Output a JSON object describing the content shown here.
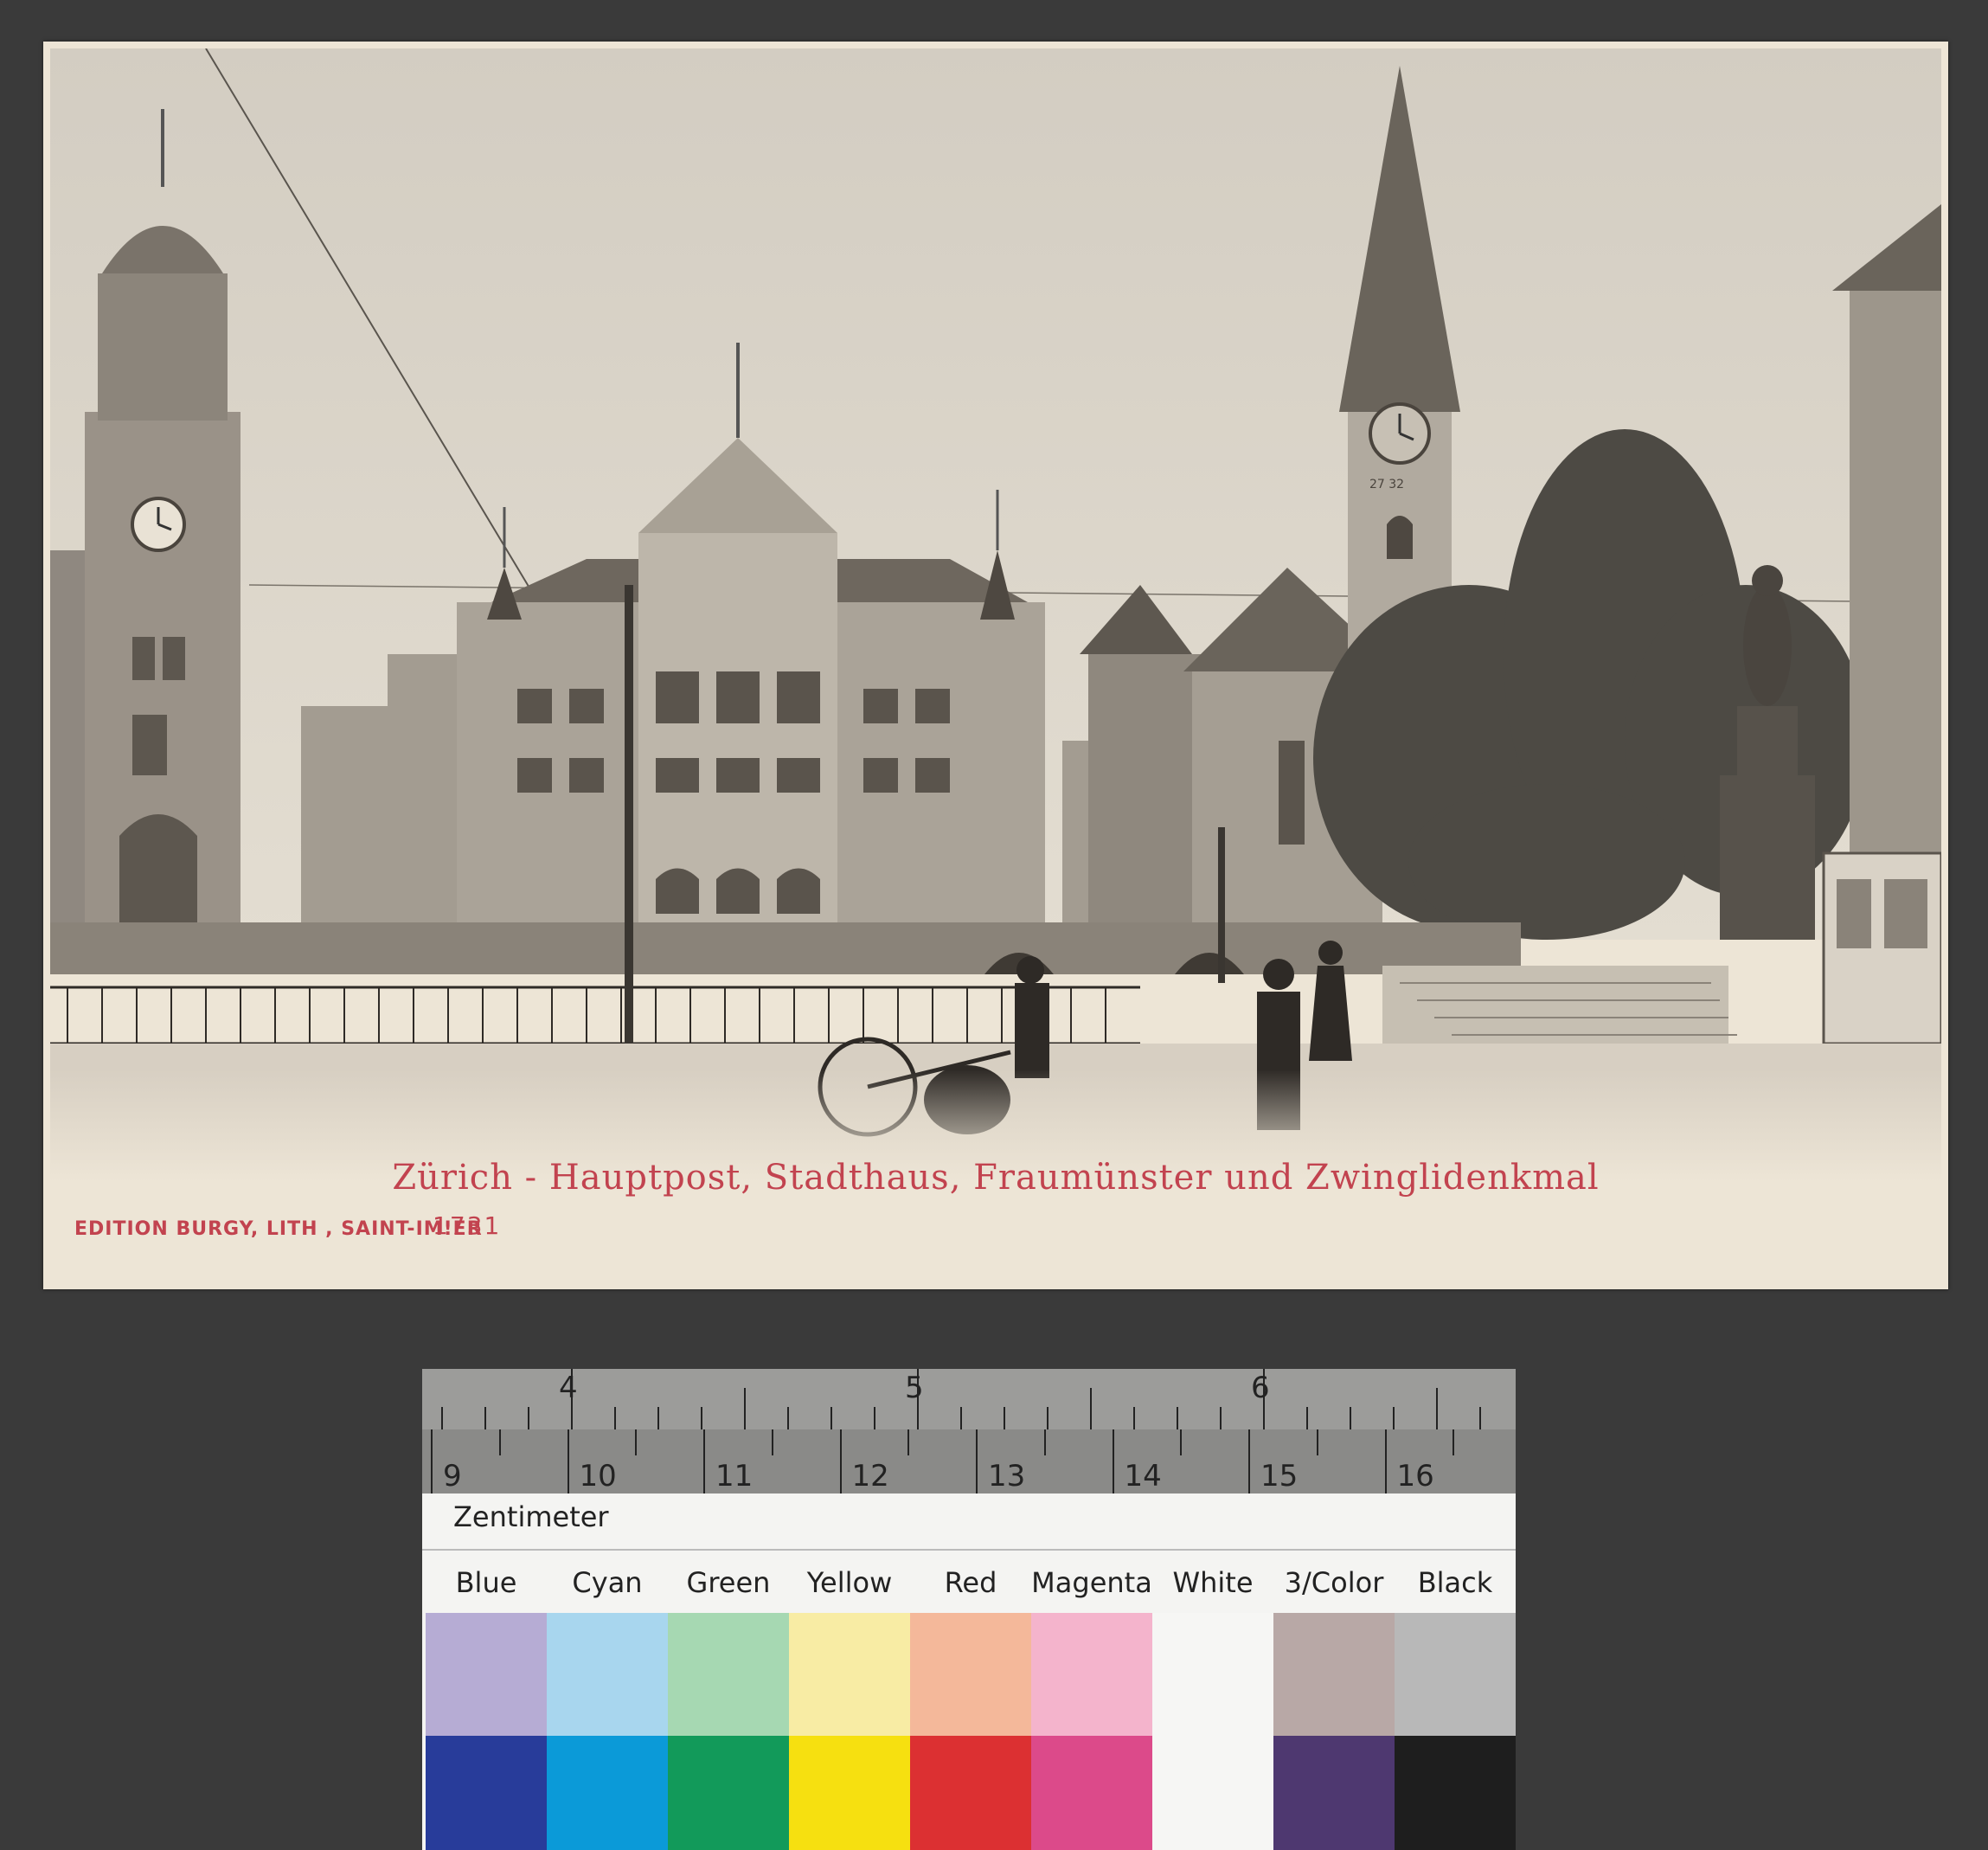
{
  "postcard": {
    "caption": "Zürich - Hauptpost, Stadthaus, Fraumünster und Zwinglidenkmal",
    "publisher": "EDITION BURGY, LITH , SAINT-IM!ER",
    "number": "1731",
    "church_clock_numerals": "27 32"
  },
  "target": {
    "inch_labels": [
      "4",
      "5",
      "6"
    ],
    "cm_labels": [
      "9",
      "10",
      "11",
      "12",
      "13",
      "14",
      "15",
      "16"
    ],
    "unit_label": "Zentimeter",
    "swatches": [
      {
        "name": "Blue",
        "light": "#b6acd4",
        "dark": "#283c9a"
      },
      {
        "name": "Cyan",
        "light": "#a8d6ee",
        "dark": "#0b9ad8"
      },
      {
        "name": "Green",
        "light": "#a6d8b2",
        "dark": "#129a5a"
      },
      {
        "name": "Yellow",
        "light": "#f8eca4",
        "dark": "#f6e010"
      },
      {
        "name": "Red",
        "light": "#f4b89a",
        "dark": "#dc3032"
      },
      {
        "name": "Magenta",
        "light": "#f4b4cc",
        "dark": "#dc4a8a"
      },
      {
        "name": "White",
        "light": "#f6f6f4",
        "dark": "#f6f6f4"
      },
      {
        "name": "3/Color",
        "light": "#b8a8a6",
        "dark": "#4e3870"
      },
      {
        "name": "Black",
        "light": "#b8b8b8",
        "dark": "#1e1e1e"
      }
    ]
  }
}
